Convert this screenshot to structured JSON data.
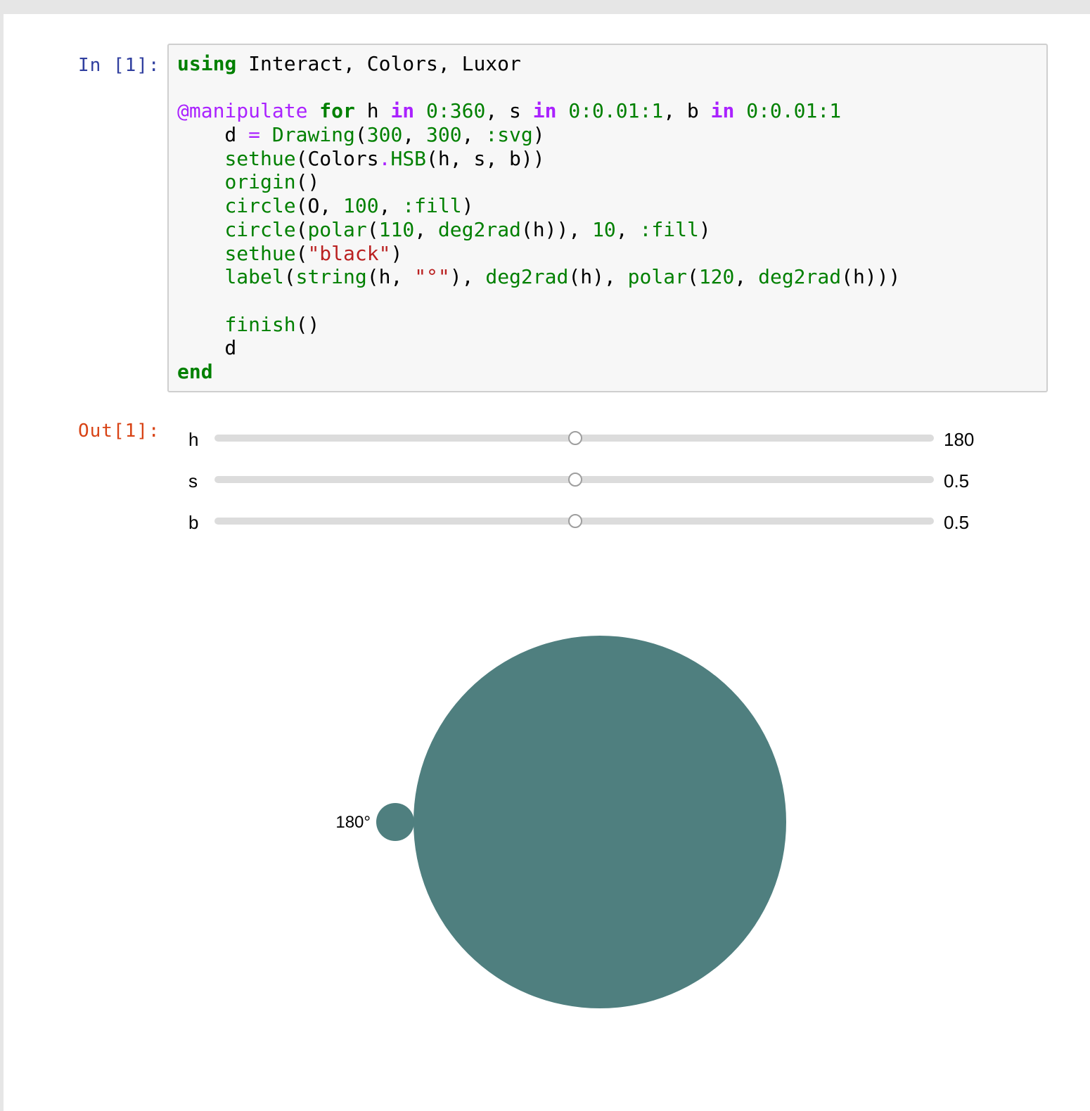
{
  "input_prompt": "In [1]:",
  "output_prompt": "Out[1]:",
  "code_lines": [
    [
      {
        "t": "using",
        "c": "kw"
      },
      {
        "t": " Interact, Colors, Luxor"
      }
    ],
    [],
    [
      {
        "t": "@manipulate",
        "c": "mac"
      },
      {
        "t": " "
      },
      {
        "t": "for",
        "c": "kw"
      },
      {
        "t": " h "
      },
      {
        "t": "in",
        "c": "kw2"
      },
      {
        "t": " "
      },
      {
        "t": "0:360",
        "c": "num"
      },
      {
        "t": ", s "
      },
      {
        "t": "in",
        "c": "kw2"
      },
      {
        "t": " "
      },
      {
        "t": "0:0.01:1",
        "c": "num"
      },
      {
        "t": ", b "
      },
      {
        "t": "in",
        "c": "kw2"
      },
      {
        "t": " "
      },
      {
        "t": "0:0.01:1",
        "c": "num"
      }
    ],
    [
      {
        "t": "    d "
      },
      {
        "t": "=",
        "c": "op"
      },
      {
        "t": " "
      },
      {
        "t": "Drawing",
        "c": "fn"
      },
      {
        "t": "("
      },
      {
        "t": "300",
        "c": "num"
      },
      {
        "t": ", "
      },
      {
        "t": "300",
        "c": "num"
      },
      {
        "t": ", "
      },
      {
        "t": ":svg",
        "c": "sym"
      },
      {
        "t": ")"
      }
    ],
    [
      {
        "t": "    "
      },
      {
        "t": "sethue",
        "c": "fn"
      },
      {
        "t": "(Colors"
      },
      {
        "t": ".",
        "c": "op"
      },
      {
        "t": "HSB",
        "c": "fn"
      },
      {
        "t": "(h, s, b))"
      }
    ],
    [
      {
        "t": "    "
      },
      {
        "t": "origin",
        "c": "fn"
      },
      {
        "t": "()"
      }
    ],
    [
      {
        "t": "    "
      },
      {
        "t": "circle",
        "c": "fn"
      },
      {
        "t": "(O, "
      },
      {
        "t": "100",
        "c": "num"
      },
      {
        "t": ", "
      },
      {
        "t": ":fill",
        "c": "sym"
      },
      {
        "t": ")"
      }
    ],
    [
      {
        "t": "    "
      },
      {
        "t": "circle",
        "c": "fn"
      },
      {
        "t": "("
      },
      {
        "t": "polar",
        "c": "fn"
      },
      {
        "t": "("
      },
      {
        "t": "110",
        "c": "num"
      },
      {
        "t": ", "
      },
      {
        "t": "deg2rad",
        "c": "fn"
      },
      {
        "t": "(h)), "
      },
      {
        "t": "10",
        "c": "num"
      },
      {
        "t": ", "
      },
      {
        "t": ":fill",
        "c": "sym"
      },
      {
        "t": ")"
      }
    ],
    [
      {
        "t": "    "
      },
      {
        "t": "sethue",
        "c": "fn"
      },
      {
        "t": "("
      },
      {
        "t": "\"black\"",
        "c": "str"
      },
      {
        "t": ")"
      }
    ],
    [
      {
        "t": "    "
      },
      {
        "t": "label",
        "c": "fn"
      },
      {
        "t": "("
      },
      {
        "t": "string",
        "c": "fn"
      },
      {
        "t": "(h, "
      },
      {
        "t": "\"°\"",
        "c": "str"
      },
      {
        "t": "), "
      },
      {
        "t": "deg2rad",
        "c": "fn"
      },
      {
        "t": "(h), "
      },
      {
        "t": "polar",
        "c": "fn"
      },
      {
        "t": "("
      },
      {
        "t": "120",
        "c": "num"
      },
      {
        "t": ", "
      },
      {
        "t": "deg2rad",
        "c": "fn"
      },
      {
        "t": "(h)))"
      }
    ],
    [],
    [
      {
        "t": "    "
      },
      {
        "t": "finish",
        "c": "fn"
      },
      {
        "t": "()"
      }
    ],
    [
      {
        "t": "    d"
      }
    ],
    [
      {
        "t": "end",
        "c": "kw"
      }
    ]
  ],
  "sliders": [
    {
      "name": "h",
      "value": "180",
      "fraction": 0.5
    },
    {
      "name": "s",
      "value": "0.5",
      "fraction": 0.5
    },
    {
      "name": "b",
      "value": "0.5",
      "fraction": 0.5
    }
  ],
  "drawing": {
    "fill_color": "#4f7f7f",
    "angle_label": "180°"
  }
}
